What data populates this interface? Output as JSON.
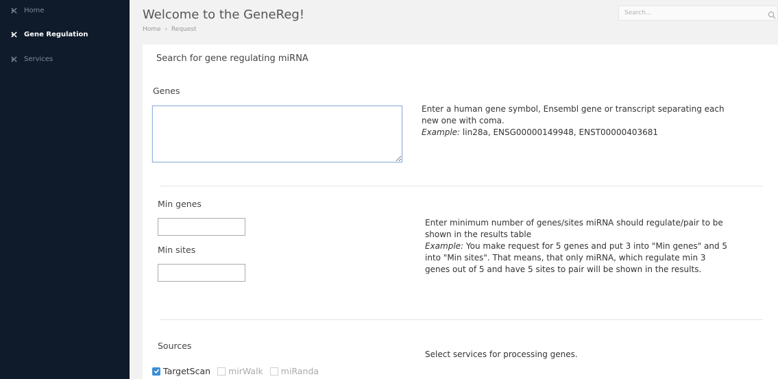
{
  "sidebar": {
    "items": [
      {
        "label": "Home",
        "icon": "plane-icon",
        "active": false
      },
      {
        "label": "Gene Regulation",
        "icon": "plane-icon",
        "active": true
      },
      {
        "label": "Services",
        "icon": "plane-icon",
        "active": false
      }
    ]
  },
  "header": {
    "title": "Welcome to the GeneReg!",
    "breadcrumb": [
      "Home",
      "Request"
    ],
    "breadcrumb_separator": "›",
    "search_placeholder": "Search..."
  },
  "form": {
    "panel_title": "Search for gene regulating miRNA",
    "genes": {
      "label": "Genes",
      "value": "",
      "help_line1": "Enter a human gene symbol, Ensembl gene or transcript separating each",
      "help_line2": "new one with coma.",
      "example_label": "Example:",
      "example_text": " lin28a, ENSG00000149948, ENST00000403681"
    },
    "min": {
      "min_genes_label": "Min genes",
      "min_genes_value": "",
      "min_sites_label": "Min sites",
      "min_sites_value": "",
      "help_line1": "Enter minimum number of genes/sites miRNA should regulate/pair to be",
      "help_line2": "shown in the results table",
      "example_label": "Example:",
      "example_line1": " You make request for 5 genes and put 3 into \"Min genes\" and 5",
      "example_line2": "into \"Min sites\". That means, that only miRNA, which regulate min 3",
      "example_line3": "genes out of 5 and have 5 sites to pair will be shown in the results."
    },
    "sources": {
      "label": "Sources",
      "help": "Select services for processing genes.",
      "options": [
        {
          "label": "TargetScan",
          "checked": true
        },
        {
          "label": "mirWalk",
          "checked": false
        },
        {
          "label": "miRanda",
          "checked": false
        }
      ]
    }
  },
  "colors": {
    "sidebar_bg": "#0f1b2a",
    "checkbox_accent": "#3a8fd6",
    "textarea_focus_border": "#8fb1de"
  }
}
